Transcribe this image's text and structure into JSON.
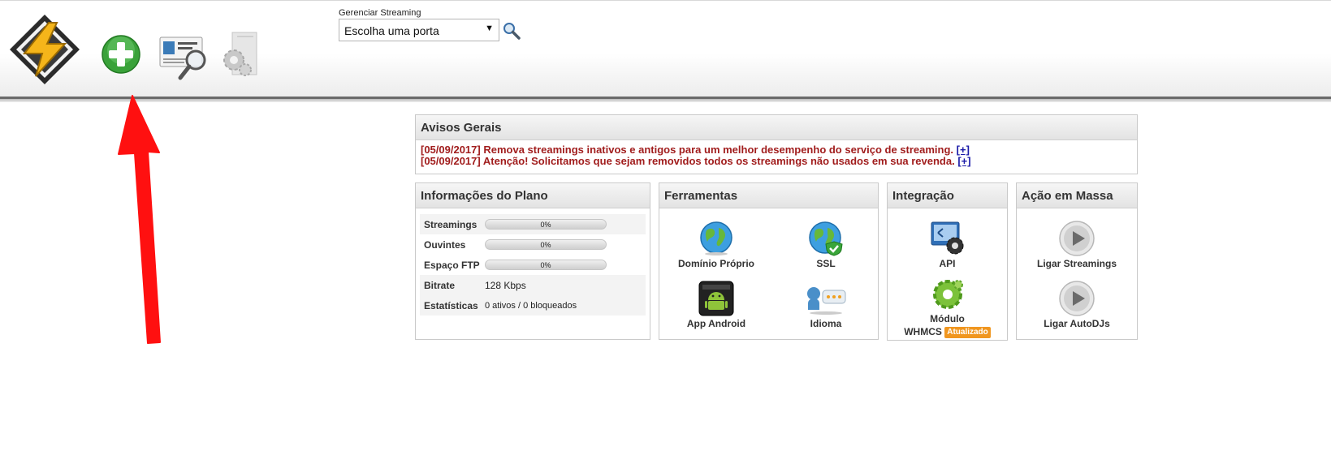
{
  "toolbar": {
    "icons": [
      "winamp-logo-icon",
      "add-icon",
      "search-card-icon",
      "settings-icon"
    ]
  },
  "gerenciar": {
    "label": "Gerenciar Streaming",
    "select_value": "Escolha uma porta"
  },
  "avisos": {
    "title": "Avisos Gerais",
    "items": [
      {
        "date": "[05/09/2017]",
        "text": "Remova streamings inativos e antigos para um melhor desempenho do serviço de streaming.",
        "more": "[+]"
      },
      {
        "date": "[05/09/2017]",
        "text": "Atenção! Solicitamos que sejam removidos todos os streamings não usados em sua revenda.",
        "more": "[+]"
      }
    ]
  },
  "plano": {
    "title": "Informações do Plano",
    "rows": [
      {
        "label": "Streamings",
        "bar_text": "0%",
        "progress": 0
      },
      {
        "label": "Ouvintes",
        "bar_text": "0%",
        "progress": 0
      },
      {
        "label": "Espaço FTP",
        "bar_text": "0%",
        "progress": 0
      },
      {
        "label": "Bitrate",
        "value": "128 Kbps"
      },
      {
        "label": "Estatísticas",
        "value": "0 ativos / 0 bloqueados"
      }
    ]
  },
  "ferramentas": {
    "title": "Ferramentas",
    "items": [
      {
        "label": "Domínio Próprio",
        "icon": "globe-icon"
      },
      {
        "label": "SSL",
        "icon": "globe-ssl-icon"
      },
      {
        "label": "App Android",
        "icon": "android-app-icon"
      },
      {
        "label": "Idioma",
        "icon": "language-icon"
      }
    ]
  },
  "integracao": {
    "title": "Integração",
    "api_label": "API",
    "whmcs_line1": "Módulo",
    "whmcs_line2": "WHMCS",
    "badge": "Atualizado"
  },
  "acao": {
    "title": "Ação em Massa",
    "items": [
      {
        "label": "Ligar Streamings",
        "icon": "play-icon"
      },
      {
        "label": "Ligar AutoDJs",
        "icon": "play-icon"
      }
    ]
  },
  "colors": {
    "notice_red": "#a11d1d",
    "link_blue": "#1a1aa8",
    "badge_orange": "#f0961f",
    "annotation_arrow": "#ff1010"
  }
}
